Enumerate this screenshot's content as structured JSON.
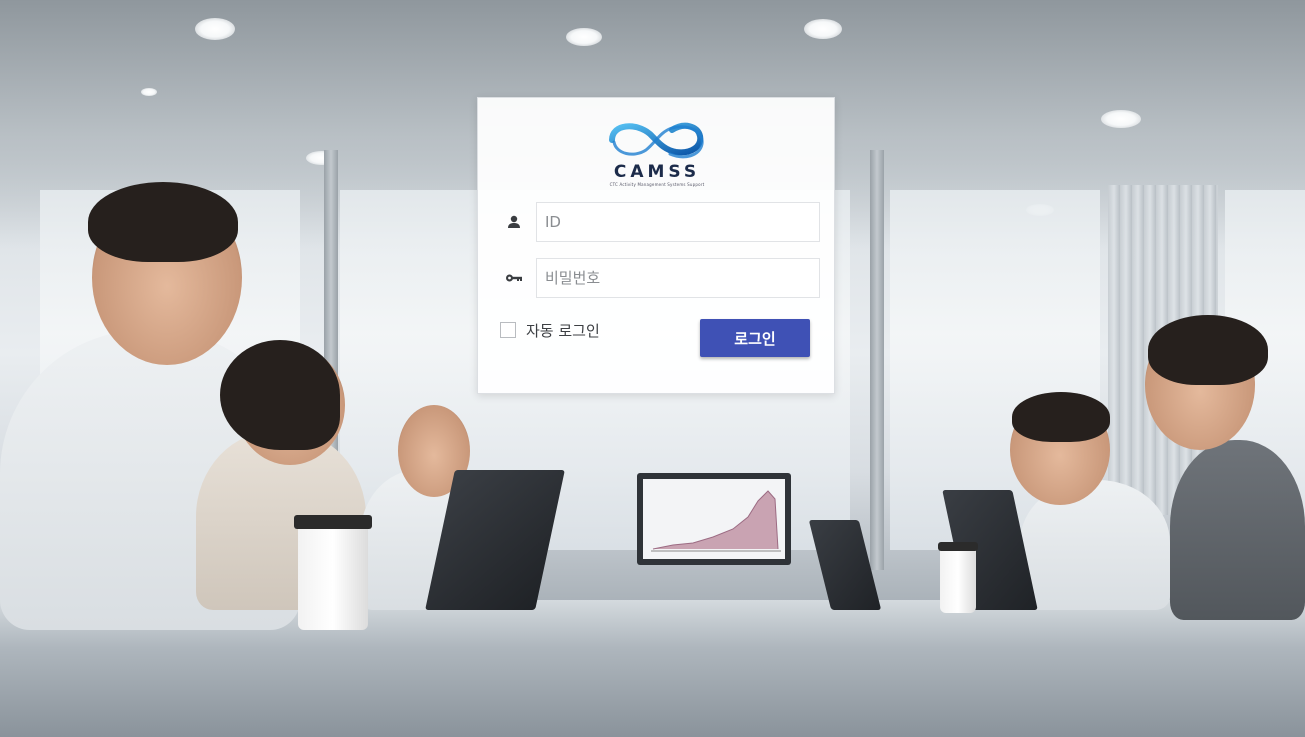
{
  "brand": {
    "name": "CAMSS",
    "tagline": "CTC Activity Management Systems Support",
    "colors": {
      "primary": "#1e8bd8",
      "secondary": "#0a4fa3",
      "text": "#1c2b4a"
    }
  },
  "login": {
    "id_placeholder": "ID",
    "password_placeholder": "비밀번호",
    "id_value": "",
    "password_value": "",
    "remember_label": "자동 로그인",
    "remember_checked": false,
    "submit_label": "로그인",
    "user_icon": "user-icon",
    "key_icon": "key-icon",
    "button_color": "#3f51b5"
  },
  "background": {
    "subject": "business-meeting-photo"
  }
}
